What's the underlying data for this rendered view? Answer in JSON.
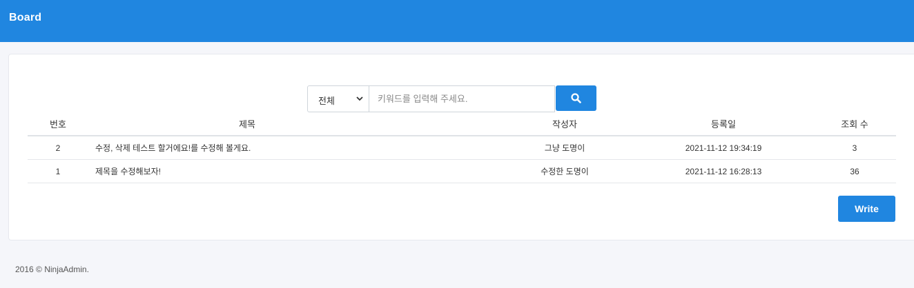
{
  "header": {
    "brand": "Board"
  },
  "search": {
    "filter_value": "전체",
    "placeholder": "키워드를 입력해 주세요.",
    "button_icon": "search-icon"
  },
  "table": {
    "columns": [
      "번호",
      "제목",
      "작성자",
      "등록일",
      "조회 수"
    ],
    "rows": [
      {
        "no": "2",
        "title": "수정, 삭제 테스트 할거에요!를 수정해 볼게요.",
        "author": "그냥 도명이",
        "date": "2021-11-12 19:34:19",
        "views": "3"
      },
      {
        "no": "1",
        "title": "제목을 수정해보자!",
        "author": "수정한 도명이",
        "date": "2021-11-12 16:28:13",
        "views": "36"
      }
    ]
  },
  "actions": {
    "write_label": "Write"
  },
  "footer": {
    "text": "2016 © NinjaAdmin."
  },
  "colors": {
    "primary": "#2086e0",
    "background": "#f5f6fa"
  }
}
